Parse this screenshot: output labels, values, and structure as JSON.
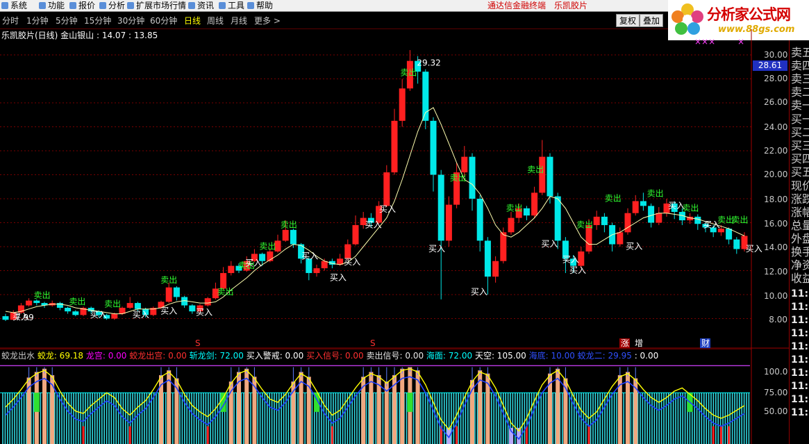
{
  "menu": {
    "items": [
      "系统",
      "功能",
      "报价",
      "分析",
      "扩展市场行情",
      "资讯",
      "工具",
      "帮助"
    ],
    "terminal": "通达信金融终端",
    "stock_title": "乐凯胶片"
  },
  "logo": {
    "title": "分析家公式网",
    "url": "www.88gs.com"
  },
  "periods": {
    "items": [
      "分时",
      "1分钟",
      "5分钟",
      "15分钟",
      "30分钟",
      "60分钟",
      "日线",
      "周线",
      "月线",
      "更多 >"
    ],
    "active": "日线"
  },
  "buttons": {
    "restore": "复权",
    "overlay": "叠加"
  },
  "title_line": "乐凯胶片(日线) 金山银山 : 14.07 : 13.85",
  "price": {
    "current": "28.61",
    "high_label": "29.32",
    "low_label": "7.99"
  },
  "axis": {
    "main": [
      "30.00",
      "28.00",
      "26.00",
      "24.00",
      "22.00",
      "20.00",
      "18.00",
      "16.00",
      "14.00",
      "12.00",
      "10.00",
      "8.00"
    ],
    "sub": [
      "100.0",
      "75.00",
      "50.00"
    ]
  },
  "signals": {
    "buy": "买入",
    "sell": "卖出"
  },
  "markers": {
    "s": "S",
    "zhang": "涨",
    "zeng": "增",
    "cai": "财"
  },
  "legend": [
    {
      "text": "蛟龙出水",
      "color": "#c8c8c8"
    },
    {
      "text": "蛟龙: 69.18",
      "color": "#ffff00"
    },
    {
      "text": "龙宫: 0.00",
      "color": "#ff00ff"
    },
    {
      "text": "蛟龙出宫: 0.00",
      "color": "#ff3030"
    },
    {
      "text": "斩龙剑: 72.00",
      "color": "#00ffff"
    },
    {
      "text": "买入警戒: 0.00",
      "color": "#ffffff"
    },
    {
      "text": "买入信号: 0.00",
      "color": "#ff3030"
    },
    {
      "text": "卖出信号: 0.00",
      "color": "#e8e8e8"
    },
    {
      "text": "海面: 72.00",
      "color": "#00ffff"
    },
    {
      "text": "天空: 105.00",
      "color": "#ffffff"
    },
    {
      "text": "海底: 10.00",
      "color": "#3050ff"
    },
    {
      "text": "蛟龙二: 29.95",
      "color": "#3050ff"
    },
    {
      "text": ": 0.00",
      "color": "#ffffff"
    }
  ],
  "quote_panel": {
    "labels": [
      "卖五",
      "卖四",
      "卖三",
      "卖二",
      "卖一",
      "买一",
      "买二",
      "买三",
      "买四",
      "买五",
      "现价",
      "涨跌",
      "涨幅",
      "总量",
      "外盘",
      "换手",
      "净资",
      "收益"
    ],
    "times": [
      "11:2",
      "11:2",
      "11:2",
      "11:2",
      "11:2",
      "11:2",
      "11:2",
      "11:2",
      "11:2",
      "11:2"
    ]
  },
  "colors": {
    "up": "#ff2020",
    "down": "#00e8e8",
    "ma": "#ffffb0",
    "grid": "#7a0000"
  },
  "candles": [
    {
      "d": 0,
      "o": 8.2,
      "c": 7.9,
      "h": 8.4,
      "l": 7.8
    },
    {
      "d": 1,
      "o": 7.9,
      "c": 8.5,
      "h": 8.7,
      "l": 7.9
    },
    {
      "d": 2,
      "o": 8.5,
      "c": 9.1,
      "h": 9.3,
      "l": 8.4
    },
    {
      "d": 3,
      "o": 9.1,
      "c": 9.5,
      "h": 9.7,
      "l": 9.0
    },
    {
      "d": 4,
      "o": 9.5,
      "c": 9.3,
      "h": 9.6,
      "l": 9.1
    },
    {
      "d": 5,
      "o": 9.3,
      "c": 9.1,
      "h": 9.4,
      "l": 8.9
    },
    {
      "d": 6,
      "o": 9.1,
      "c": 9.3,
      "h": 9.5,
      "l": 9.0
    },
    {
      "d": 7,
      "o": 9.3,
      "c": 8.9,
      "h": 9.4,
      "l": 8.7
    },
    {
      "d": 8,
      "o": 8.9,
      "c": 8.6,
      "h": 9.0,
      "l": 8.4
    },
    {
      "d": 9,
      "o": 8.6,
      "c": 8.3,
      "h": 8.7,
      "l": 8.2
    },
    {
      "d": 10,
      "o": 8.3,
      "c": 8.9,
      "h": 9.0,
      "l": 8.2
    },
    {
      "d": 11,
      "o": 8.9,
      "c": 8.6,
      "h": 9.0,
      "l": 8.4
    },
    {
      "d": 12,
      "o": 8.6,
      "c": 8.3,
      "h": 8.7,
      "l": 8.1
    },
    {
      "d": 13,
      "o": 8.3,
      "c": 8.0,
      "h": 8.4,
      "l": 7.9
    },
    {
      "d": 14,
      "o": 8.0,
      "c": 8.4,
      "h": 8.5,
      "l": 7.9
    },
    {
      "d": 15,
      "o": 8.4,
      "c": 8.9,
      "h": 9.0,
      "l": 8.3
    },
    {
      "d": 16,
      "o": 8.9,
      "c": 9.3,
      "h": 9.8,
      "l": 8.8
    },
    {
      "d": 17,
      "o": 9.3,
      "c": 8.8,
      "h": 9.4,
      "l": 8.6
    },
    {
      "d": 18,
      "o": 8.8,
      "c": 8.3,
      "h": 8.9,
      "l": 8.1
    },
    {
      "d": 19,
      "o": 8.3,
      "c": 8.9,
      "h": 9.0,
      "l": 8.2
    },
    {
      "d": 20,
      "o": 8.9,
      "c": 9.4,
      "h": 9.5,
      "l": 8.8
    },
    {
      "d": 21,
      "o": 9.4,
      "c": 10.6,
      "h": 11.0,
      "l": 9.3
    },
    {
      "d": 22,
      "o": 10.6,
      "c": 9.8,
      "h": 10.7,
      "l": 9.5
    },
    {
      "d": 23,
      "o": 9.8,
      "c": 9.1,
      "h": 9.9,
      "l": 8.9
    },
    {
      "d": 24,
      "o": 9.1,
      "c": 8.6,
      "h": 9.2,
      "l": 8.4
    },
    {
      "d": 25,
      "o": 8.6,
      "c": 9.1,
      "h": 9.2,
      "l": 8.5
    },
    {
      "d": 26,
      "o": 9.1,
      "c": 9.7,
      "h": 9.8,
      "l": 9.0
    },
    {
      "d": 27,
      "o": 9.7,
      "c": 10.5,
      "h": 11.0,
      "l": 9.6
    },
    {
      "d": 28,
      "o": 10.5,
      "c": 11.8,
      "h": 12.3,
      "l": 10.4
    },
    {
      "d": 29,
      "o": 11.8,
      "c": 12.4,
      "h": 12.8,
      "l": 11.6
    },
    {
      "d": 30,
      "o": 12.4,
      "c": 12.0,
      "h": 12.6,
      "l": 11.8
    },
    {
      "d": 31,
      "o": 12.0,
      "c": 12.8,
      "h": 13.2,
      "l": 11.9
    },
    {
      "d": 32,
      "o": 12.8,
      "c": 13.4,
      "h": 13.8,
      "l": 12.7
    },
    {
      "d": 33,
      "o": 13.4,
      "c": 12.8,
      "h": 13.5,
      "l": 12.4
    },
    {
      "d": 34,
      "o": 12.8,
      "c": 13.6,
      "h": 13.8,
      "l": 12.7
    },
    {
      "d": 35,
      "o": 13.6,
      "c": 14.5,
      "h": 15.0,
      "l": 13.5
    },
    {
      "d": 36,
      "o": 14.5,
      "c": 15.4,
      "h": 16.2,
      "l": 14.4
    },
    {
      "d": 37,
      "o": 15.4,
      "c": 14.2,
      "h": 15.5,
      "l": 13.9
    },
    {
      "d": 38,
      "o": 14.2,
      "c": 13.0,
      "h": 14.3,
      "l": 12.6
    },
    {
      "d": 39,
      "o": 13.0,
      "c": 11.8,
      "h": 13.1,
      "l": 11.2
    },
    {
      "d": 40,
      "o": 11.8,
      "c": 12.2,
      "h": 12.5,
      "l": 11.5
    },
    {
      "d": 41,
      "o": 12.2,
      "c": 12.8,
      "h": 13.0,
      "l": 12.0
    },
    {
      "d": 42,
      "o": 12.8,
      "c": 12.5,
      "h": 13.0,
      "l": 12.2
    },
    {
      "d": 43,
      "o": 12.5,
      "c": 13.0,
      "h": 13.4,
      "l": 12.4
    },
    {
      "d": 44,
      "o": 13.0,
      "c": 14.2,
      "h": 14.6,
      "l": 12.9
    },
    {
      "d": 45,
      "o": 14.2,
      "c": 15.8,
      "h": 16.6,
      "l": 14.1
    },
    {
      "d": 46,
      "o": 15.8,
      "c": 16.4,
      "h": 16.9,
      "l": 15.5
    },
    {
      "d": 47,
      "o": 16.4,
      "c": 16.0,
      "h": 16.8,
      "l": 15.6
    },
    {
      "d": 48,
      "o": 16.0,
      "c": 17.4,
      "h": 17.8,
      "l": 15.9
    },
    {
      "d": 49,
      "o": 17.4,
      "c": 20.2,
      "h": 20.8,
      "l": 17.3
    },
    {
      "d": 50,
      "o": 20.2,
      "c": 24.5,
      "h": 25.5,
      "l": 20.0
    },
    {
      "d": 51,
      "o": 24.5,
      "c": 27.2,
      "h": 28.0,
      "l": 24.0
    },
    {
      "d": 52,
      "o": 27.2,
      "c": 29.5,
      "h": 30.4,
      "l": 27.0
    },
    {
      "d": 53,
      "o": 29.5,
      "c": 28.6,
      "h": 29.9,
      "l": 27.6
    },
    {
      "d": 54,
      "o": 28.6,
      "c": 24.5,
      "h": 28.8,
      "l": 23.8
    },
    {
      "d": 55,
      "o": 24.5,
      "c": 20.0,
      "h": 24.8,
      "l": 18.6
    },
    {
      "d": 56,
      "o": 20.0,
      "c": 14.5,
      "h": 20.4,
      "l": 9.6
    },
    {
      "d": 57,
      "o": 14.5,
      "c": 17.5,
      "h": 18.2,
      "l": 14.0
    },
    {
      "d": 58,
      "o": 17.5,
      "c": 20.2,
      "h": 21.0,
      "l": 17.2
    },
    {
      "d": 59,
      "o": 20.2,
      "c": 21.5,
      "h": 22.4,
      "l": 19.8
    },
    {
      "d": 60,
      "o": 21.5,
      "c": 18.0,
      "h": 21.8,
      "l": 17.0
    },
    {
      "d": 61,
      "o": 18.0,
      "c": 14.5,
      "h": 18.3,
      "l": 13.6
    },
    {
      "d": 62,
      "o": 14.5,
      "c": 11.5,
      "h": 14.8,
      "l": 10.0
    },
    {
      "d": 63,
      "o": 11.5,
      "c": 12.8,
      "h": 13.2,
      "l": 11.0
    },
    {
      "d": 64,
      "o": 12.8,
      "c": 15.2,
      "h": 15.6,
      "l": 12.6
    },
    {
      "d": 65,
      "o": 15.2,
      "c": 16.4,
      "h": 16.9,
      "l": 15.0
    },
    {
      "d": 66,
      "o": 16.4,
      "c": 17.2,
      "h": 17.6,
      "l": 16.0
    },
    {
      "d": 67,
      "o": 17.2,
      "c": 16.6,
      "h": 17.4,
      "l": 16.2
    },
    {
      "d": 68,
      "o": 16.6,
      "c": 18.5,
      "h": 19.0,
      "l": 16.4
    },
    {
      "d": 69,
      "o": 18.5,
      "c": 21.5,
      "h": 22.9,
      "l": 18.3
    },
    {
      "d": 70,
      "o": 21.5,
      "c": 18.2,
      "h": 21.8,
      "l": 17.6
    },
    {
      "d": 71,
      "o": 18.2,
      "c": 14.5,
      "h": 18.5,
      "l": 13.8
    },
    {
      "d": 72,
      "o": 14.5,
      "c": 13.0,
      "h": 14.8,
      "l": 11.8
    },
    {
      "d": 73,
      "o": 13.0,
      "c": 12.4,
      "h": 13.3,
      "l": 11.8
    },
    {
      "d": 74,
      "o": 12.4,
      "c": 13.6,
      "h": 14.0,
      "l": 12.2
    },
    {
      "d": 75,
      "o": 13.6,
      "c": 15.8,
      "h": 16.3,
      "l": 13.4
    },
    {
      "d": 76,
      "o": 15.8,
      "c": 16.5,
      "h": 17.0,
      "l": 15.4
    },
    {
      "d": 77,
      "o": 16.5,
      "c": 15.8,
      "h": 16.8,
      "l": 15.2
    },
    {
      "d": 78,
      "o": 15.8,
      "c": 14.2,
      "h": 16.0,
      "l": 13.6
    },
    {
      "d": 79,
      "o": 14.2,
      "c": 15.2,
      "h": 15.6,
      "l": 14.0
    },
    {
      "d": 80,
      "o": 15.2,
      "c": 16.8,
      "h": 17.2,
      "l": 15.0
    },
    {
      "d": 81,
      "o": 16.8,
      "c": 17.8,
      "h": 18.3,
      "l": 16.6
    },
    {
      "d": 82,
      "o": 17.8,
      "c": 17.4,
      "h": 18.5,
      "l": 17.0
    },
    {
      "d": 83,
      "o": 17.4,
      "c": 16.0,
      "h": 17.6,
      "l": 15.6
    },
    {
      "d": 84,
      "o": 16.0,
      "c": 16.8,
      "h": 17.3,
      "l": 15.8
    },
    {
      "d": 85,
      "o": 16.8,
      "c": 17.6,
      "h": 18.0,
      "l": 16.5
    },
    {
      "d": 86,
      "o": 17.6,
      "c": 16.9,
      "h": 17.8,
      "l": 16.3
    },
    {
      "d": 87,
      "o": 16.9,
      "c": 16.2,
      "h": 17.2,
      "l": 15.8
    },
    {
      "d": 88,
      "o": 16.2,
      "c": 16.5,
      "h": 16.8,
      "l": 15.9
    },
    {
      "d": 89,
      "o": 16.5,
      "c": 15.9,
      "h": 16.7,
      "l": 15.4
    },
    {
      "d": 90,
      "o": 15.9,
      "c": 15.6,
      "h": 16.0,
      "l": 15.2
    },
    {
      "d": 91,
      "o": 15.6,
      "c": 15.2,
      "h": 15.8,
      "l": 14.8
    },
    {
      "d": 92,
      "o": 15.2,
      "c": 15.5,
      "h": 15.8,
      "l": 14.9
    },
    {
      "d": 93,
      "o": 15.5,
      "c": 14.6,
      "h": 15.6,
      "l": 14.2
    },
    {
      "d": 94,
      "o": 14.6,
      "c": 13.8,
      "h": 14.8,
      "l": 13.4
    },
    {
      "d": 95,
      "o": 13.8,
      "c": 14.9,
      "h": 15.2,
      "l": 13.6
    }
  ],
  "ma": [
    8.6,
    8.5,
    8.6,
    8.8,
    9.0,
    9.1,
    9.2,
    9.2,
    9.1,
    8.9,
    8.8,
    8.7,
    8.6,
    8.5,
    8.4,
    8.4,
    8.6,
    8.8,
    8.8,
    8.8,
    8.9,
    9.2,
    9.4,
    9.5,
    9.4,
    9.3,
    9.3,
    9.4,
    9.8,
    10.4,
    10.9,
    11.4,
    12.0,
    12.5,
    12.9,
    13.3,
    13.8,
    14.2,
    14.1,
    13.7,
    13.2,
    12.8,
    12.6,
    12.5,
    12.7,
    13.2,
    14.0,
    14.8,
    15.6,
    16.4,
    17.8,
    19.6,
    21.6,
    23.6,
    25.2,
    25.6,
    24.2,
    22.6,
    21.0,
    19.6,
    19.2,
    18.4,
    17.2,
    15.8,
    15.0,
    14.8,
    15.2,
    15.8,
    16.4,
    17.2,
    18.2,
    18.0,
    17.2,
    16.0,
    14.8,
    14.2,
    14.2,
    14.6,
    15.0,
    15.2,
    15.6,
    16.0,
    16.4,
    16.6,
    16.8,
    16.8,
    16.7,
    16.6,
    16.4,
    16.3,
    16.1,
    15.9,
    15.7,
    15.5,
    15.2,
    14.9
  ],
  "signal_marks": [
    {
      "d": 1,
      "type": "buy",
      "p": 7.9
    },
    {
      "d": 4,
      "type": "sell",
      "p": 9.7
    },
    {
      "d": 9,
      "type": "sell",
      "p": 9.2
    },
    {
      "d": 12,
      "type": "buy",
      "p": 8.1
    },
    {
      "d": 14,
      "type": "sell",
      "p": 9.0
    },
    {
      "d": 18,
      "type": "buy",
      "p": 8.1
    },
    {
      "d": 22,
      "type": "buy",
      "p": 8.4
    },
    {
      "d": 22,
      "type": "sell",
      "p": 11.0
    },
    {
      "d": 27,
      "type": "buy",
      "p": 8.3
    },
    {
      "d": 30,
      "type": "sell",
      "p": 10.0
    },
    {
      "d": 33,
      "type": "sell",
      "p": 12.2
    },
    {
      "d": 34,
      "type": "buy",
      "p": 12.4
    },
    {
      "d": 36,
      "type": "sell",
      "p": 13.8
    },
    {
      "d": 39,
      "type": "sell",
      "p": 15.6
    },
    {
      "d": 42,
      "type": "buy",
      "p": 13.0
    },
    {
      "d": 46,
      "type": "buy",
      "p": 11.2
    },
    {
      "d": 48,
      "type": "buy",
      "p": 12.5
    },
    {
      "d": 51,
      "type": "buy",
      "p": 15.6
    },
    {
      "d": 53,
      "type": "buy",
      "p": 16.9
    },
    {
      "d": 56,
      "type": "sell",
      "p": 28.3
    },
    {
      "d": 60,
      "type": "buy",
      "p": 13.6
    },
    {
      "d": 63,
      "type": "sell",
      "p": 19.5
    },
    {
      "d": 66,
      "type": "buy",
      "p": 10.0
    },
    {
      "d": 71,
      "type": "sell",
      "p": 17.0
    },
    {
      "d": 74,
      "type": "sell",
      "p": 20.2
    },
    {
      "d": 76,
      "type": "buy",
      "p": 14.0
    },
    {
      "d": 79,
      "type": "buy",
      "p": 12.7
    },
    {
      "d": 80,
      "type": "buy",
      "p": 11.8
    },
    {
      "d": 81,
      "type": "sell",
      "p": 15.6
    },
    {
      "d": 85,
      "type": "sell",
      "p": 17.8
    },
    {
      "d": 88,
      "type": "buy",
      "p": 13.8
    },
    {
      "d": 91,
      "type": "sell",
      "p": 18.2
    },
    {
      "d": 94,
      "type": "buy",
      "p": 17.2
    },
    {
      "d": 96,
      "type": "sell",
      "p": 17.0
    },
    {
      "d": 99,
      "type": "buy",
      "p": 15.6
    },
    {
      "d": 101,
      "type": "sell",
      "p": 16.0
    },
    {
      "d": 103,
      "type": "sell",
      "p": 16.0
    },
    {
      "d": 105,
      "type": "buy",
      "p": 13.6
    }
  ],
  "indicator": {
    "line": [
      50,
      60,
      72,
      85,
      92,
      96,
      88,
      70,
      55,
      45,
      42,
      52,
      60,
      68,
      62,
      48,
      40,
      50,
      58,
      72,
      88,
      94,
      84,
      66,
      52,
      44,
      38,
      48,
      62,
      80,
      92,
      96,
      86,
      72,
      60,
      56,
      66,
      80,
      92,
      86,
      70,
      52,
      40,
      46,
      60,
      74,
      86,
      92,
      88,
      80,
      88,
      96,
      98,
      94,
      78,
      56,
      34,
      22,
      40,
      62,
      82,
      94,
      90,
      74,
      52,
      30,
      20,
      36,
      58,
      78,
      90,
      96,
      84,
      64,
      46,
      36,
      44,
      60,
      76,
      88,
      92,
      84,
      72,
      62,
      56,
      62,
      70,
      74,
      66,
      58,
      48,
      40,
      36,
      40,
      46,
      52
    ],
    "levels": {
      "sea": 72,
      "sky": 105,
      "floor": 10
    },
    "min": 0,
    "max": 110
  }
}
